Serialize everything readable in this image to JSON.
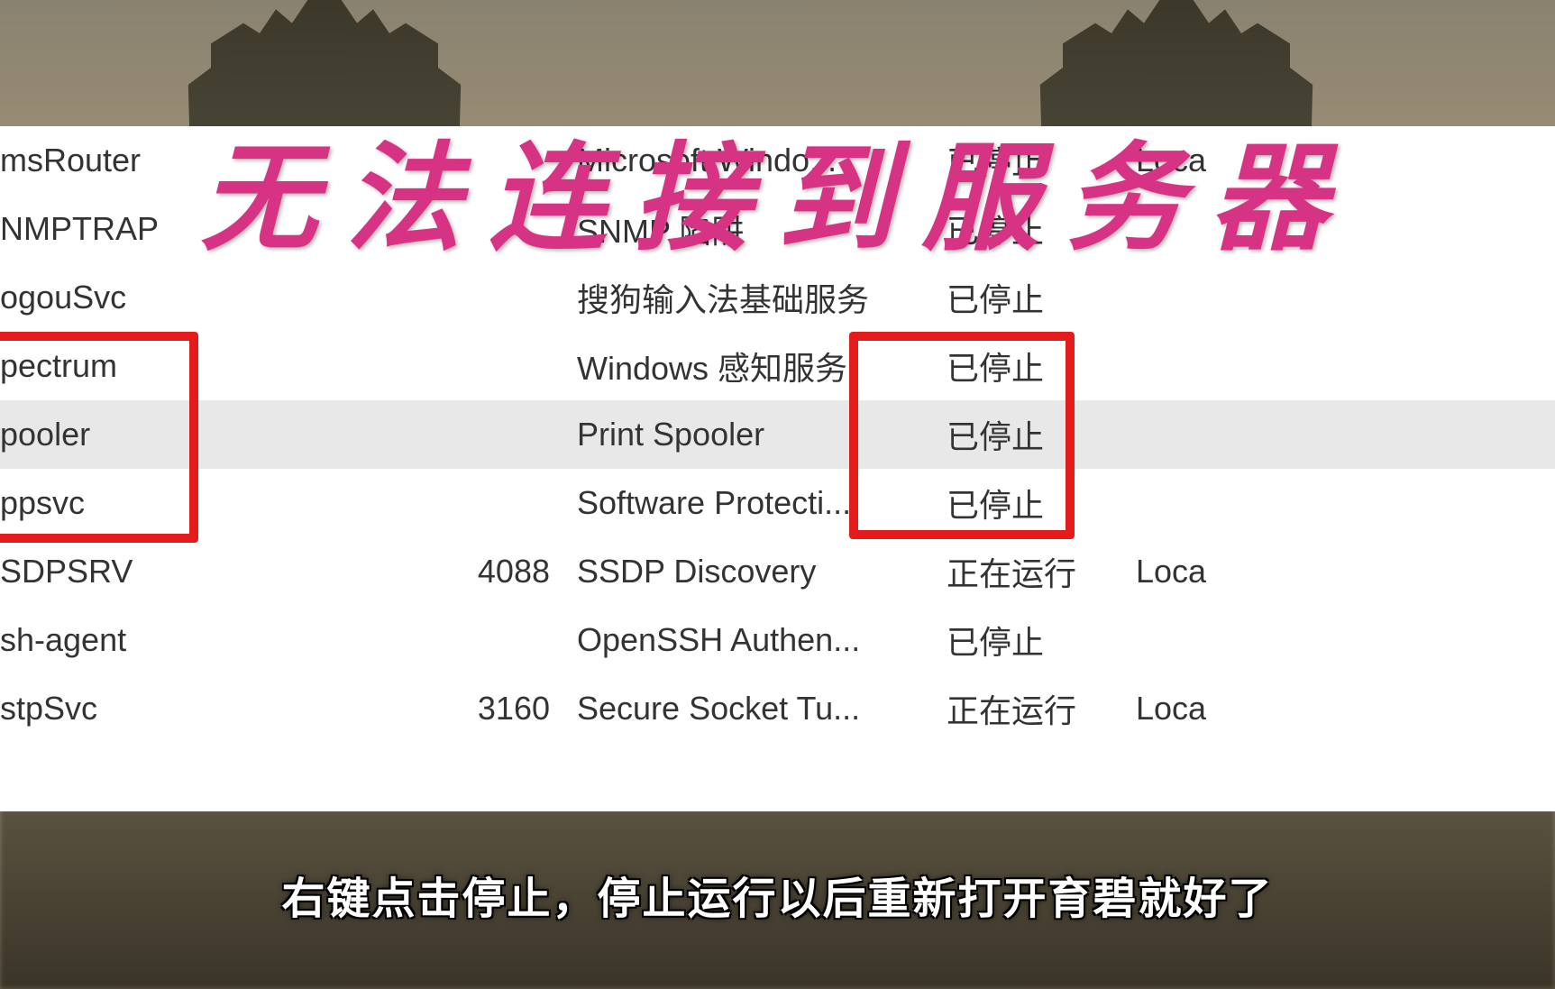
{
  "title_overlay": "无法连接到服务器",
  "subtitle": "右键点击停止，停止运行以后重新打开育碧就好了",
  "services": [
    {
      "name": "msRouter",
      "pid": "",
      "description": "Microsoft Windo...",
      "status": "已停止",
      "group": "Loca"
    },
    {
      "name": "NMPTRAP",
      "pid": "",
      "description": "SNMP 陷阱",
      "status": "已停止",
      "group": ""
    },
    {
      "name": "ogouSvc",
      "pid": "",
      "description": "搜狗输入法基础服务",
      "status": "已停止",
      "group": ""
    },
    {
      "name": "pectrum",
      "pid": "",
      "description": "Windows 感知服务",
      "status": "已停止",
      "group": ""
    },
    {
      "name": "pooler",
      "pid": "",
      "description": "Print Spooler",
      "status": "已停止",
      "group": ""
    },
    {
      "name": "ppsvc",
      "pid": "",
      "description": "Software Protecti...",
      "status": "已停止",
      "group": ""
    },
    {
      "name": "SDPSRV",
      "pid": "4088",
      "description": "SSDP Discovery",
      "status": "正在运行",
      "group": "Loca"
    },
    {
      "name": "sh-agent",
      "pid": "",
      "description": "OpenSSH Authen...",
      "status": "已停止",
      "group": ""
    },
    {
      "name": "stpSvc",
      "pid": "3160",
      "description": "Secure Socket Tu...",
      "status": "正在运行",
      "group": "Loca"
    }
  ]
}
